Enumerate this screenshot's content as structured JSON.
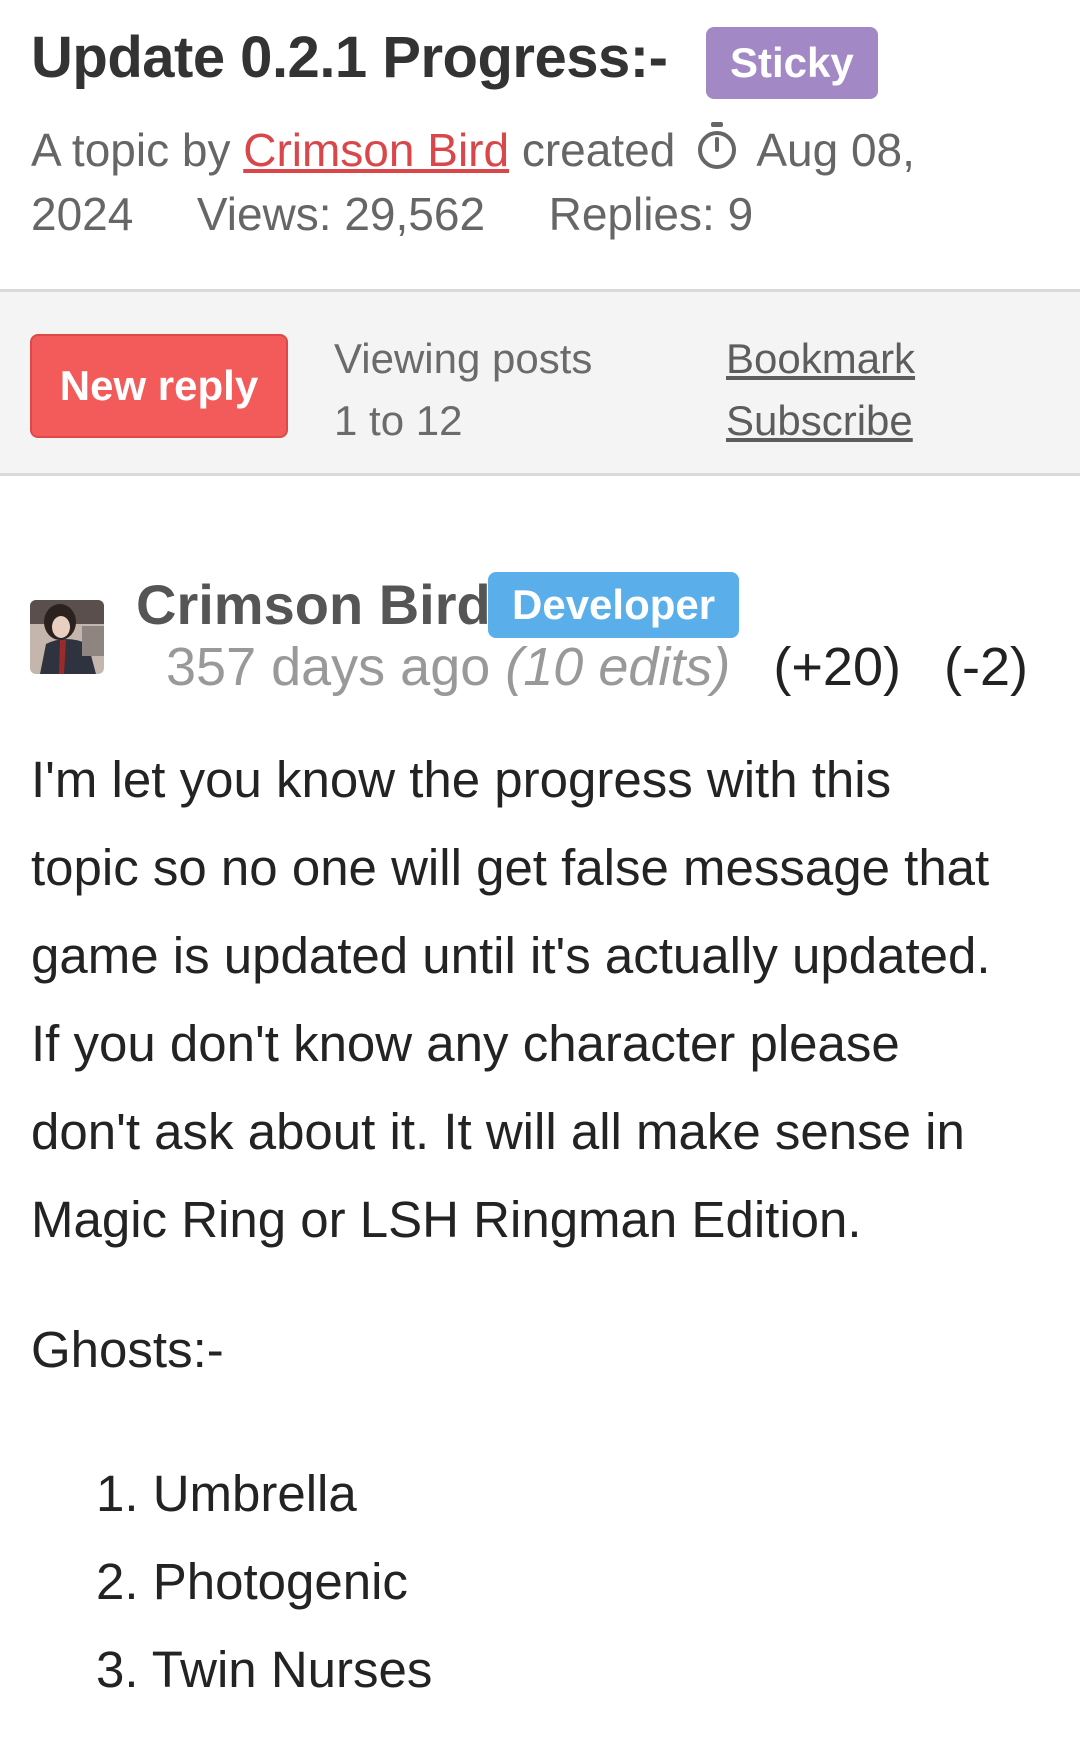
{
  "topic": {
    "title": "Update 0.2.1 Progress:-",
    "badge": "Sticky",
    "prefix": "A topic by",
    "author": "Crimson Bird",
    "created_label": "created",
    "date_part1": "Aug 08,",
    "date_part2": "2024",
    "views": "Views: 29,562",
    "replies": "Replies: 9"
  },
  "toolbar": {
    "new_reply": "New reply",
    "viewing_line1": "Viewing posts",
    "viewing_line2": "1 to 12",
    "bookmark": "Bookmark",
    "subscribe": "Subscribe"
  },
  "post": {
    "author": "Crimson Bird",
    "role_badge": "Developer",
    "time_ago": "357 days ago",
    "edits": "(10 edits)",
    "upvotes": "(+20)",
    "downvotes": "(-2)",
    "body_lines": [
      "I'm let you know the progress with this",
      "topic so no one will get false message that",
      "game is updated until it's actually updated.",
      "If you don't know any character please",
      "don't ask about it. It will all make sense in",
      "Magic Ring or LSH Ringman Edition."
    ],
    "section_heading": "Ghosts:-",
    "ghosts": [
      "1. Umbrella",
      "2. Photogenic",
      "3. Twin Nurses"
    ]
  },
  "colors": {
    "sticky_badge": "#a388c6",
    "developer_badge": "#5aafea",
    "new_reply_button": "#f35b5b",
    "author_link": "#d9474a"
  },
  "icons": {
    "clock": "stopwatch-icon"
  }
}
